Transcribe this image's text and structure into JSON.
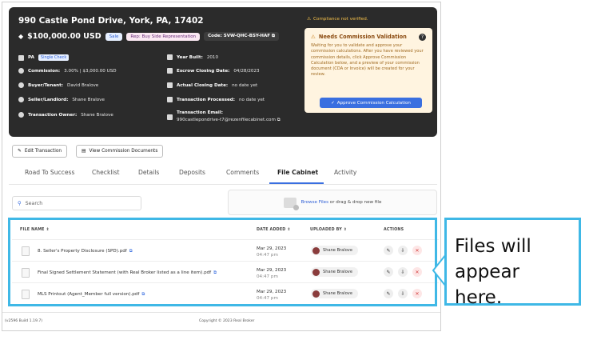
{
  "transaction": {
    "address": "990 Castle Pond Drive, York, PA, 17402",
    "price": "$100,000.00 USD",
    "sale_chip": "Sale",
    "rep_chip": "Rep: Buy Side Representation",
    "code_chip": "Code: SVW-QHC-BSY-HAF",
    "state": "PA",
    "state_check": "Single Check",
    "commission_label": "Commission:",
    "commission_value": "3.00% | $3,000.00 USD",
    "buyer_label": "Buyer/Tenant:",
    "buyer_value": "David Bralove",
    "seller_label": "Seller/Landlord:",
    "seller_value": "Shane Bralove",
    "owner_label": "Transaction Owner:",
    "owner_value": "Shane Bralove",
    "year_label": "Year Built:",
    "year_value": "2010",
    "escrow_label": "Escrow Closing Date:",
    "escrow_value": "04/28/2023",
    "actual_label": "Actual Closing Date:",
    "actual_value": "no date yet",
    "processed_label": "Transaction Processed:",
    "processed_value": "no date yet",
    "email_label": "Transaction Email:",
    "email_value": "990castlepondrive-t7@rezenfilecabinet.com"
  },
  "compliance": {
    "warning": "Compliance not verified.",
    "title": "Needs Commission Validation",
    "body": "Waiting for you to validate and approve your commission calculations. After you have reviewed your commission details, click Approve Commission Calculation below, and a preview of your commission document (CDA or Invoice) will be created for your review.",
    "button": "Approve Commission Calculation"
  },
  "actions": {
    "edit": "Edit Transaction",
    "view_docs": "View Commission Documents"
  },
  "tabs": [
    "Road To Success",
    "Checklist",
    "Details",
    "Deposits",
    "Comments",
    "File Cabinet",
    "Activity"
  ],
  "active_tab": "File Cabinet",
  "search_placeholder": "Search",
  "upload": {
    "browse": "Browse Files",
    "rest": "or drag & drop new file"
  },
  "table": {
    "headers": [
      "FILE NAME ⇕",
      "DATE ADDED ⇕",
      "UPLOADED BY ⇕",
      "ACTIONS"
    ],
    "rows": [
      {
        "name": "8. Seller's Property Disclosure (SPD).pdf",
        "date": "Mar 29, 2023",
        "time": "04:47 pm",
        "user": "Shane Bralove"
      },
      {
        "name": "Final Signed Settlement Statement (with Real Broker listed as a line item).pdf",
        "date": "Mar 29, 2023",
        "time": "04:47 pm",
        "user": "Shane Bralove"
      },
      {
        "name": "MLS Printout (Agent_Member full version).pdf",
        "date": "Mar 29, 2023",
        "time": "04:47 pm",
        "user": "Shane Bralove"
      }
    ]
  },
  "footer": {
    "build": "(v2596 Build 1.19.7)",
    "copyright": "Copyright © 2023 Real Broker"
  },
  "callout": "Files will appear here.",
  "colors": {
    "accent": "#3a6fe0",
    "highlight": "#3fb8e6",
    "warning": "#f5c04a"
  }
}
